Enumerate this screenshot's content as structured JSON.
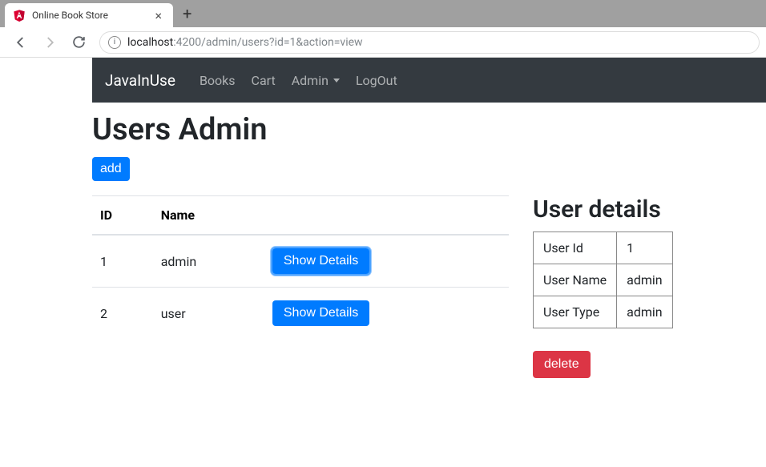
{
  "browser": {
    "tab_title": "Online Book Store",
    "url_host": "localhost",
    "url_rest": ":4200/admin/users?id=1&action=view"
  },
  "navbar": {
    "brand": "JavaInUse",
    "links": {
      "books": "Books",
      "cart": "Cart",
      "admin": "Admin",
      "logout": "LogOut"
    }
  },
  "page": {
    "title": "Users Admin",
    "add_label": "add"
  },
  "users_table": {
    "headers": {
      "id": "ID",
      "name": "Name"
    },
    "rows": [
      {
        "id": "1",
        "name": "admin",
        "show_label": "Show Details"
      },
      {
        "id": "2",
        "name": "user",
        "show_label": "Show Details"
      }
    ]
  },
  "details": {
    "title": "User details",
    "rows": {
      "user_id_label": "User Id",
      "user_id_value": "1",
      "user_name_label": "User Name",
      "user_name_value": "admin",
      "user_type_label": "User Type",
      "user_type_value": "admin"
    },
    "delete_label": "delete"
  }
}
